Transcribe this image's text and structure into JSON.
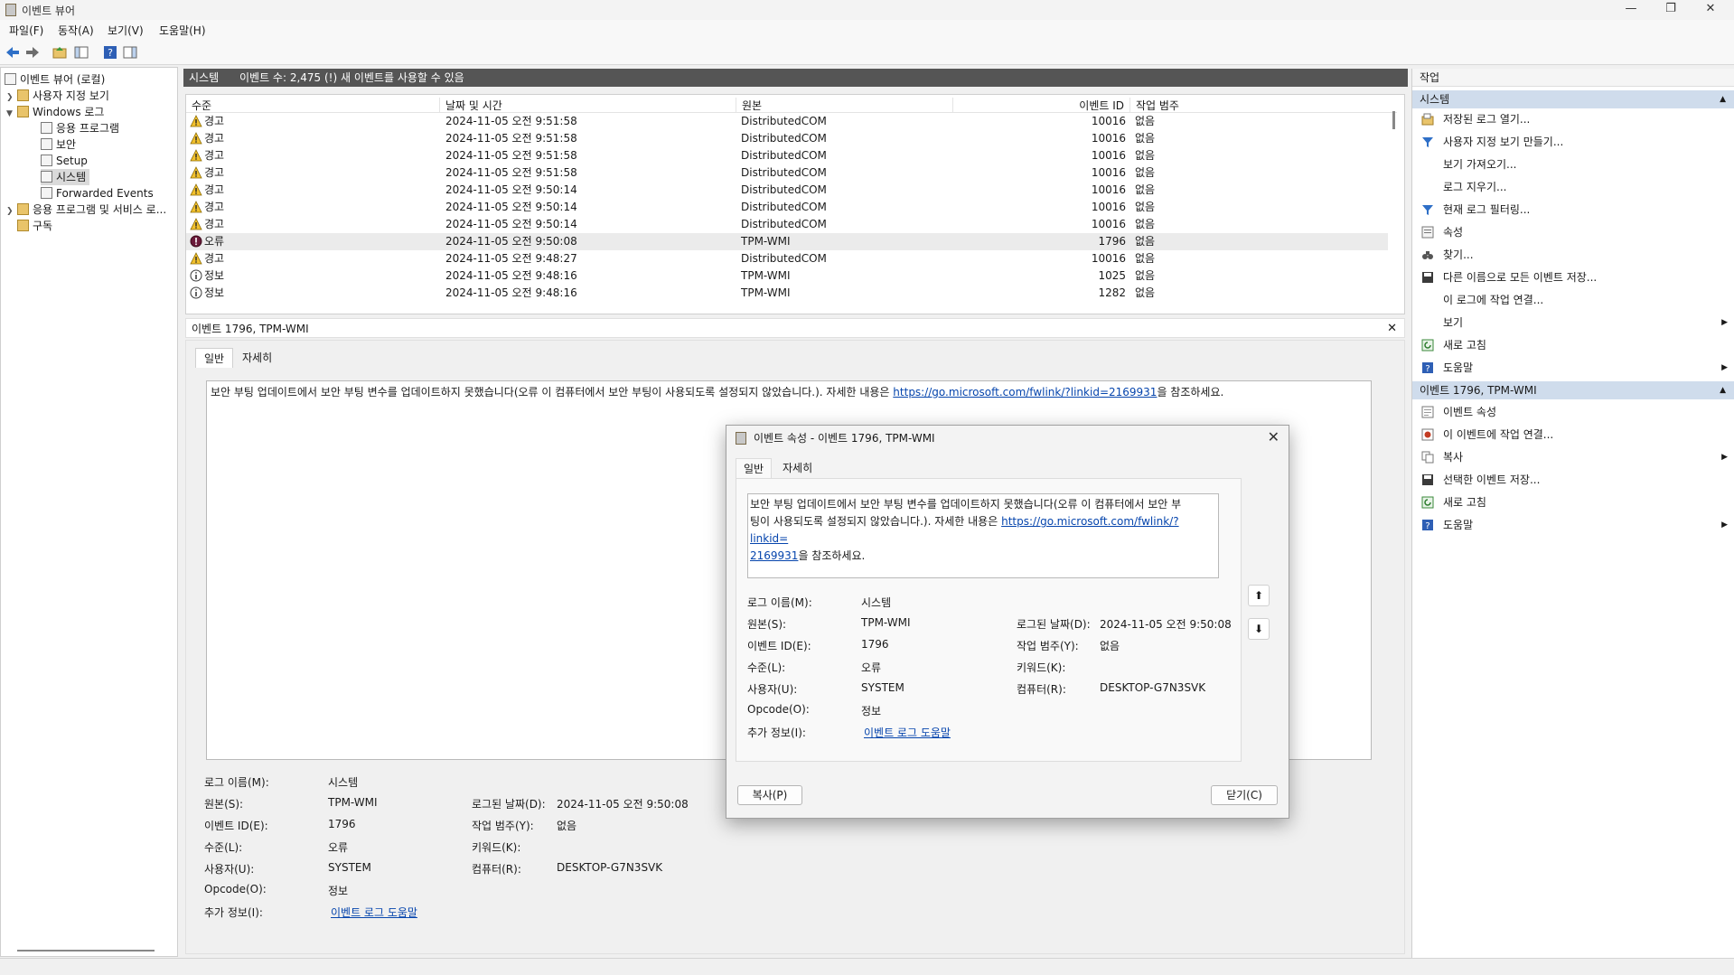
{
  "window": {
    "title": "이벤트 뷰어",
    "min": "—",
    "max": "❐",
    "close": "✕"
  },
  "menu": [
    "파일(F)",
    "동작(A)",
    "보기(V)",
    "도움말(H)"
  ],
  "tree": {
    "root": "이벤트 뷰어 (로컬)",
    "custom_views": "사용자 지정 보기",
    "windows_logs": "Windows 로그",
    "application": "응용 프로그램",
    "security": "보안",
    "setup": "Setup",
    "system": "시스템",
    "forwarded": "Forwarded Events",
    "apps_services": "응용 프로그램 및 서비스 로...",
    "subscriptions": "구독"
  },
  "center": {
    "log_name": "시스템",
    "event_count": "이벤트 수: 2,475 (!) 새 이벤트를 사용할 수 있음"
  },
  "grid": {
    "headers": {
      "level": "수준",
      "date": "날짜 및 시간",
      "source": "원본",
      "event_id": "이벤트 ID",
      "category": "작업 범주"
    },
    "rows": [
      {
        "level": "경고",
        "type": "warning",
        "date": "2024-11-05 오전 9:51:58",
        "source": "DistributedCOM",
        "id": "10016",
        "category": "없음"
      },
      {
        "level": "경고",
        "type": "warning",
        "date": "2024-11-05 오전 9:51:58",
        "source": "DistributedCOM",
        "id": "10016",
        "category": "없음"
      },
      {
        "level": "경고",
        "type": "warning",
        "date": "2024-11-05 오전 9:51:58",
        "source": "DistributedCOM",
        "id": "10016",
        "category": "없음"
      },
      {
        "level": "경고",
        "type": "warning",
        "date": "2024-11-05 오전 9:51:58",
        "source": "DistributedCOM",
        "id": "10016",
        "category": "없음"
      },
      {
        "level": "경고",
        "type": "warning",
        "date": "2024-11-05 오전 9:50:14",
        "source": "DistributedCOM",
        "id": "10016",
        "category": "없음"
      },
      {
        "level": "경고",
        "type": "warning",
        "date": "2024-11-05 오전 9:50:14",
        "source": "DistributedCOM",
        "id": "10016",
        "category": "없음"
      },
      {
        "level": "경고",
        "type": "warning",
        "date": "2024-11-05 오전 9:50:14",
        "source": "DistributedCOM",
        "id": "10016",
        "category": "없음"
      },
      {
        "level": "오류",
        "type": "error",
        "date": "2024-11-05 오전 9:50:08",
        "source": "TPM-WMI",
        "id": "1796",
        "category": "없음"
      },
      {
        "level": "경고",
        "type": "warning",
        "date": "2024-11-05 오전 9:48:27",
        "source": "DistributedCOM",
        "id": "10016",
        "category": "없음"
      },
      {
        "level": "정보",
        "type": "info",
        "date": "2024-11-05 오전 9:48:16",
        "source": "TPM-WMI",
        "id": "1025",
        "category": "없음"
      },
      {
        "level": "정보",
        "type": "info",
        "date": "2024-11-05 오전 9:48:16",
        "source": "TPM-WMI",
        "id": "1282",
        "category": "없음"
      }
    ]
  },
  "detail": {
    "title": "이벤트 1796, TPM-WMI",
    "tab_general": "일반",
    "tab_details": "자세히",
    "message_text": "보안 부팅 업데이트에서 보안 부팅 변수를 업데이트하지 못했습니다(오류 이 컴퓨터에서 보안 부팅이 사용되도록 설정되지 않았습니다.). 자세한 내용은 ",
    "message_link": "https://go.microsoft.com/fwlink/?linkid=2169931",
    "message_suffix": "을 참조하세요.",
    "fields": {
      "log_name_label": "로그 이름(M):",
      "log_name": "시스템",
      "source_label": "원본(S):",
      "source": "TPM-WMI",
      "logged_label": "로그된 날짜(D):",
      "logged": "2024-11-05 오전 9:50:08",
      "event_id_label": "이벤트 ID(E):",
      "event_id": "1796",
      "task_label": "작업 범주(Y):",
      "task": "없음",
      "level_label": "수준(L):",
      "level": "오류",
      "keywords_label": "키워드(K):",
      "user_label": "사용자(U):",
      "user": "SYSTEM",
      "computer_label": "컴퓨터(R):",
      "computer": "DESKTOP-G7N3SVK",
      "opcode_label": "Opcode(O):",
      "opcode": "정보",
      "more_label": "추가 정보(I):",
      "more_link": "이벤트 로그 도움말"
    }
  },
  "actions": {
    "header": "작업",
    "section1": "시스템",
    "items1": [
      "저장된 로그 열기...",
      "사용자 지정 보기 만들기...",
      "보기 가져오기...",
      "로그 지우기...",
      "현재 로그 필터링...",
      "속성",
      "찾기...",
      "다른 이름으로 모든 이벤트 저장...",
      "이 로그에 작업 연결...",
      "보기",
      "새로 고침",
      "도움말"
    ],
    "section2": "이벤트 1796, TPM-WMI",
    "items2": [
      "이벤트 속성",
      "이 이벤트에 작업 연결...",
      "복사",
      "선택한 이벤트 저장...",
      "새로 고침",
      "도움말"
    ]
  },
  "dialog": {
    "title": "이벤트 속성 - 이벤트 1796, TPM-WMI",
    "tab_general": "일반",
    "tab_details": "자세히",
    "msg_line1": "보안 부팅 업데이트에서 보안 부팅 변수를 업데이트하지 못했습니다(오류 이 컴퓨터에서 보안 부",
    "msg_line2_text": "팅이 사용되도록 설정되지 않았습니다.). 자세한 내용은 ",
    "msg_line2_link": "https://go.microsoft.com/fwlink/?linkid=",
    "msg_line3_link": "2169931",
    "msg_line3_text": "을 참조하세요.",
    "copy_button": "복사(P)",
    "close_button": "닫기(C)"
  }
}
